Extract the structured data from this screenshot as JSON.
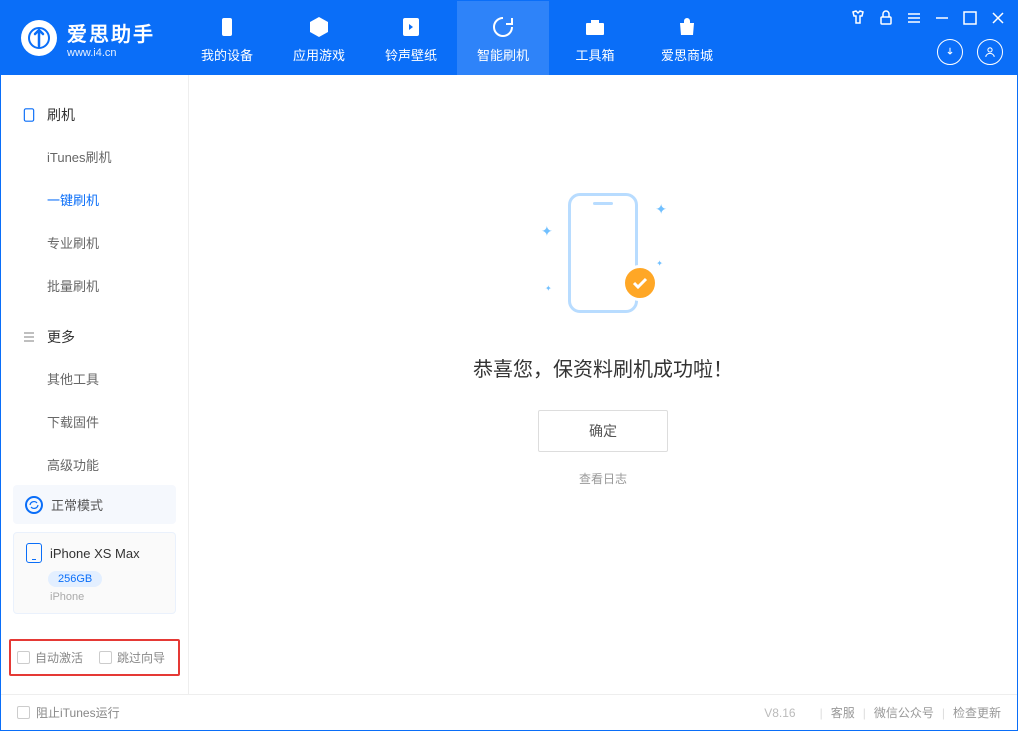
{
  "brand": {
    "title": "爱思助手",
    "subtitle": "www.i4.cn"
  },
  "nav": [
    {
      "label": "我的设备"
    },
    {
      "label": "应用游戏"
    },
    {
      "label": "铃声壁纸"
    },
    {
      "label": "智能刷机"
    },
    {
      "label": "工具箱"
    },
    {
      "label": "爱思商城"
    }
  ],
  "sidebar": {
    "group1": {
      "title": "刷机",
      "items": [
        "iTunes刷机",
        "一键刷机",
        "专业刷机",
        "批量刷机"
      ]
    },
    "group2": {
      "title": "更多",
      "items": [
        "其他工具",
        "下载固件",
        "高级功能"
      ]
    }
  },
  "mode": {
    "label": "正常模式"
  },
  "device": {
    "name": "iPhone XS Max",
    "storage": "256GB",
    "type": "iPhone"
  },
  "options": {
    "auto_activate": "自动激活",
    "skip_guide": "跳过向导"
  },
  "main": {
    "success_text": "恭喜您，保资料刷机成功啦！",
    "ok": "确定",
    "view_log": "查看日志"
  },
  "footer": {
    "block_itunes": "阻止iTunes运行",
    "version": "V8.16",
    "service": "客服",
    "wechat": "微信公众号",
    "update": "检查更新"
  }
}
